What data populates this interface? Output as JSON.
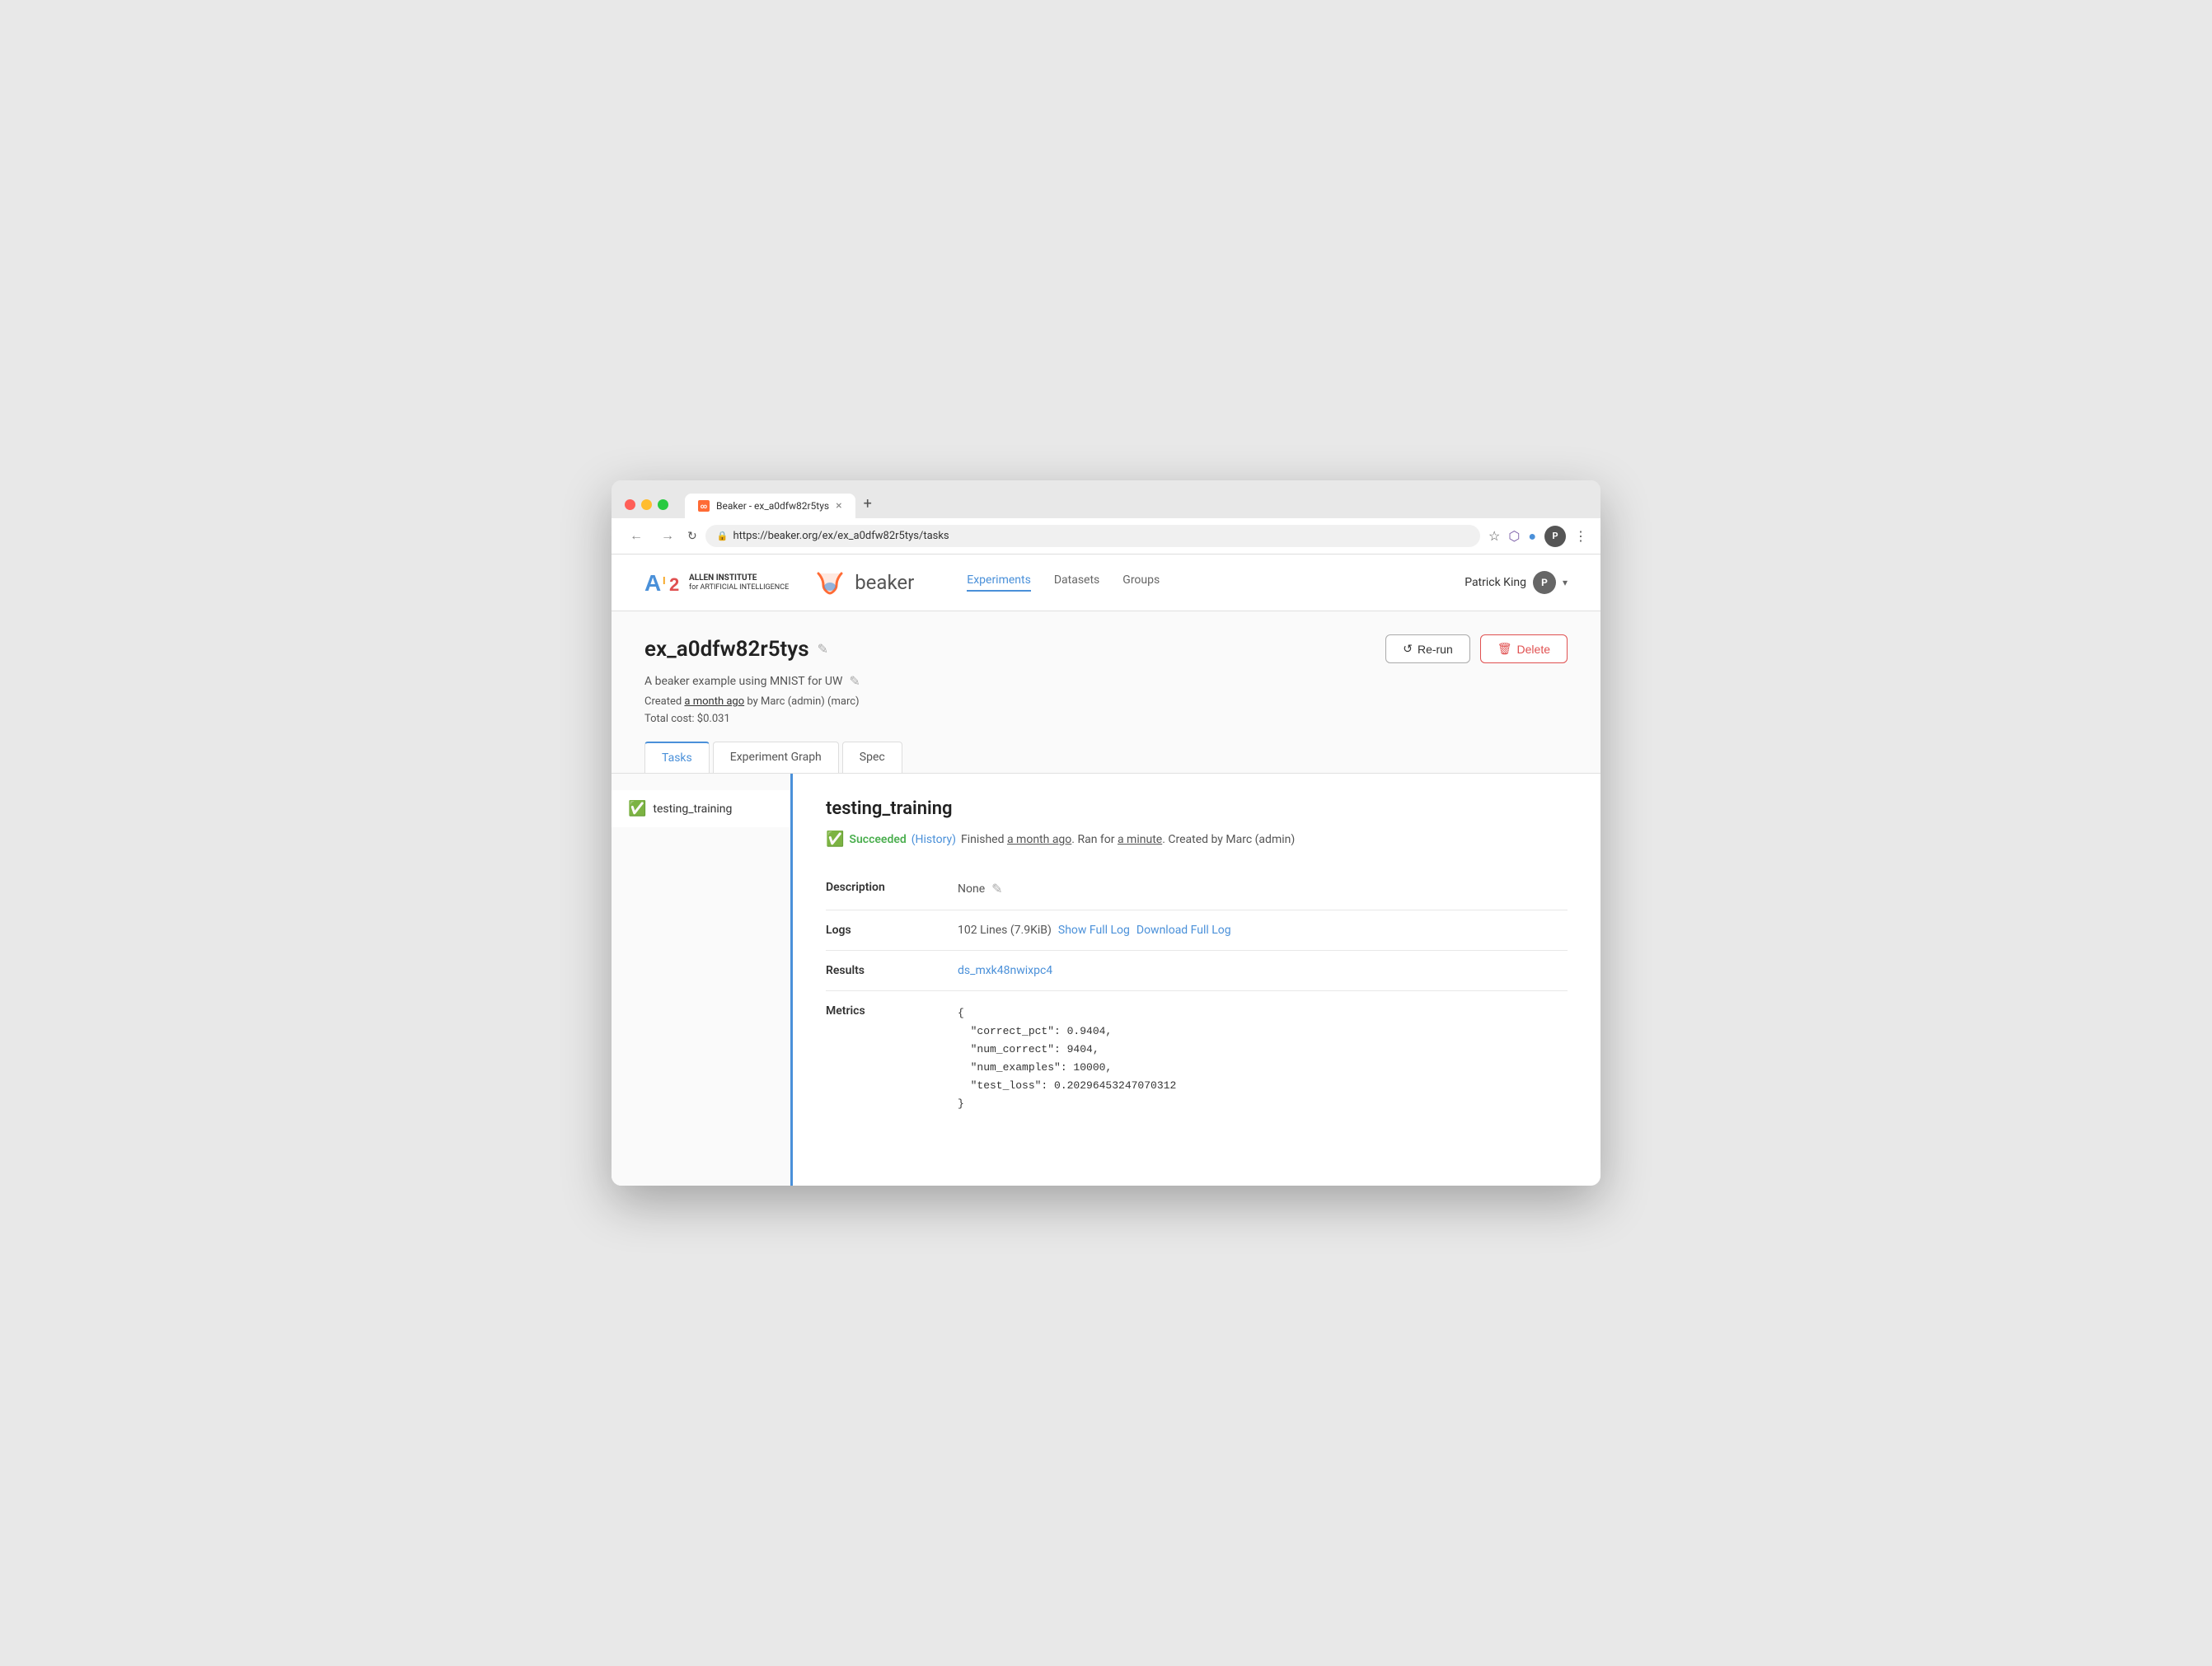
{
  "browser": {
    "tab_title": "Beaker - ex_a0dfw82r5tys",
    "tab_favicon": "∞",
    "url": "https://beaker.org/ex/ex_a0dfw82r5tys/tasks",
    "new_tab_label": "+",
    "close_tab_label": "×"
  },
  "toolbar": {
    "avatar_initial": "P"
  },
  "nav": {
    "links": [
      {
        "label": "Experiments",
        "active": true
      },
      {
        "label": "Datasets",
        "active": false
      },
      {
        "label": "Groups",
        "active": false
      }
    ],
    "user_name": "Patrick King",
    "user_initial": "P"
  },
  "experiment": {
    "title": "ex_a0dfw82r5tys",
    "description": "A beaker example using MNIST for UW",
    "meta": "Created a month ago by Marc (admin) (marc)",
    "cost": "Total cost: $0.031",
    "rerun_label": "Re-run",
    "delete_label": "Delete"
  },
  "tabs": [
    {
      "label": "Tasks",
      "active": true
    },
    {
      "label": "Experiment Graph",
      "active": false
    },
    {
      "label": "Spec",
      "active": false
    }
  ],
  "task": {
    "sidebar_item": "testing_training",
    "title": "testing_training",
    "status": "Succeeded",
    "status_history": "(History)",
    "status_meta": "Finished a month ago. Ran for a minute. Created by Marc (admin)",
    "description_label": "Description",
    "description_value": "None",
    "logs_label": "Logs",
    "logs_info": "102 Lines (7.9KiB)",
    "show_full_log": "Show Full Log",
    "download_full_log": "Download Full Log",
    "results_label": "Results",
    "results_link": "ds_mxk48nwixpc4",
    "metrics_label": "Metrics",
    "metrics_json": "{\n  \"correct_pct\": 0.9404,\n  \"num_correct\": 9404,\n  \"num_examples\": 10000,\n  \"test_loss\": 0.20296453247070312\n}"
  },
  "colors": {
    "accent": "#4a90d9",
    "success": "#4caf50",
    "delete": "#e05050",
    "border": "#e0e0e0"
  }
}
